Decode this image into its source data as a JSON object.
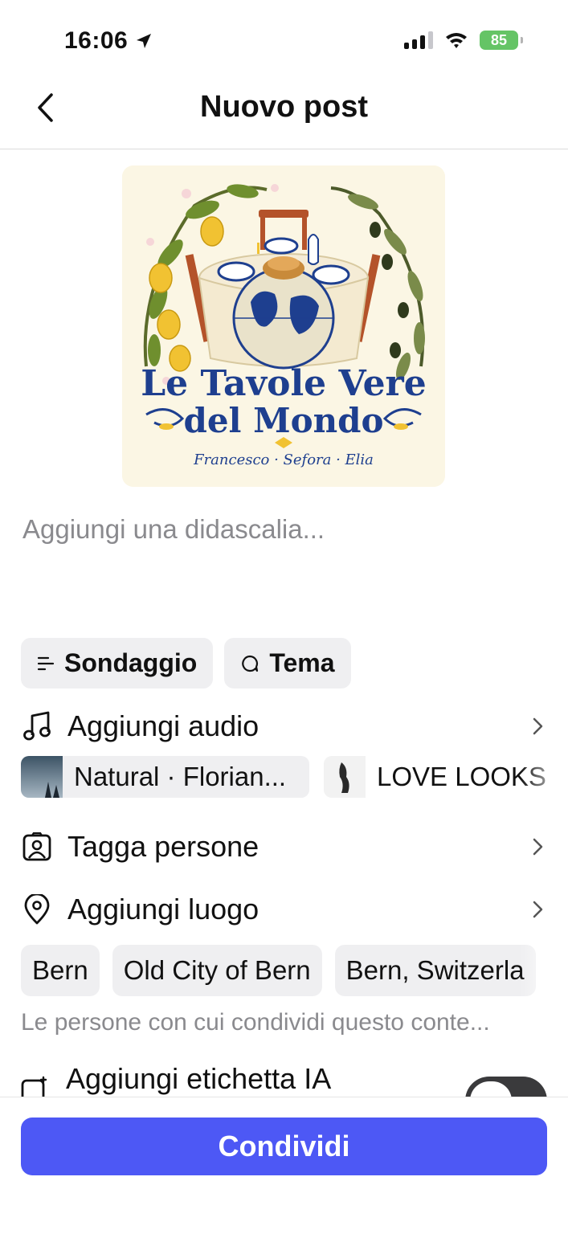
{
  "status_bar": {
    "time": "16:06",
    "battery": "85",
    "battery_color": "#65c466"
  },
  "header": {
    "title": "Nuovo post",
    "back_icon": "chevron-left-icon"
  },
  "post_image": {
    "title_line1": "Le Tavole Vere",
    "title_line2": "del Mondo",
    "signature": "Francesco · Sefora · Elia"
  },
  "caption": {
    "placeholder": "Aggiungi una didascalia..."
  },
  "chips": [
    {
      "label": "Sondaggio",
      "icon": "poll-icon"
    },
    {
      "label": "Tema",
      "icon": "topic-bubble-icon"
    }
  ],
  "rows": {
    "audio": {
      "label": "Aggiungi audio",
      "icon": "music-note-icon"
    },
    "tag": {
      "label": "Tagga persone",
      "icon": "tag-person-icon"
    },
    "location": {
      "label": "Aggiungi luogo",
      "icon": "location-pin-icon"
    },
    "ai_label": {
      "label": "Aggiungi etichetta IA",
      "icon": "ai-label-icon"
    }
  },
  "audio_suggestions": [
    {
      "label": "Natural · Florian..."
    },
    {
      "label": "LOVE LOOKS"
    }
  ],
  "place_suggestions": [
    "Bern",
    "Old City of Bern",
    "Bern, Switzerla"
  ],
  "share_note": "Le persone con cui condividi questo conte...",
  "share_button": {
    "label": "Condividi",
    "color": "#4d58f5"
  }
}
